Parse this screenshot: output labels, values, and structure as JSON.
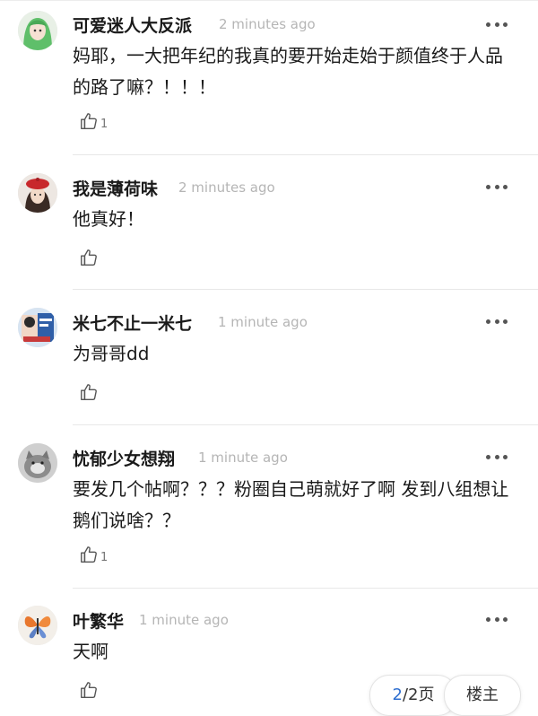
{
  "comments": [
    {
      "author": "可爱迷人大反派",
      "time": "2 minutes ago",
      "text": "妈耶，一大把年纪的我真的要开始走始于颜值终于人品的路了嘛？！！！",
      "likes": "1",
      "avatar": "green-hair-anime-avatar"
    },
    {
      "author": "我是薄荷味",
      "time": "2 minutes ago",
      "text": "他真好！",
      "likes": "",
      "avatar": "girl-red-beret-avatar"
    },
    {
      "author": "米七不止一米七",
      "time": "1 minute ago",
      "text": "为哥哥dd",
      "likes": "",
      "avatar": "poster-photo-avatar"
    },
    {
      "author": "忧郁少女想翔",
      "time": "1 minute ago",
      "text": "要发几个帖啊？？？粉圈自己萌就好了啊 发到八组想让鹅们说啥？？",
      "likes": "1",
      "avatar": "gray-cat-avatar"
    },
    {
      "author": "叶繁华",
      "time": "1 minute ago",
      "text": "天啊",
      "likes": "",
      "avatar": "butterfly-avatar"
    }
  ],
  "pager": {
    "current": "2",
    "label": "/2页"
  },
  "owner_button": "楼主",
  "icons": {
    "more": "more-dots-icon",
    "like": "thumbs-up-icon"
  },
  "colors": {
    "time": "#b5b5b5",
    "pager_current": "#2f6fd0"
  }
}
